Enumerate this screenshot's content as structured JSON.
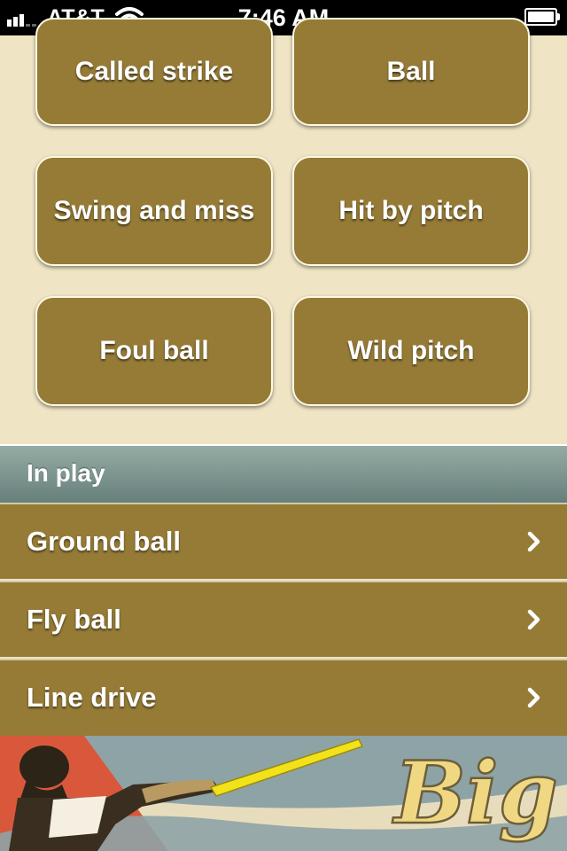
{
  "status_bar": {
    "carrier": "AT&T",
    "time": "7:46 AM"
  },
  "pitch_buttons": [
    {
      "label": "Called strike"
    },
    {
      "label": "Ball"
    },
    {
      "label": "Swing and miss"
    },
    {
      "label": "Hit by pitch"
    },
    {
      "label": "Foul ball"
    },
    {
      "label": "Wild pitch"
    }
  ],
  "in_play": {
    "header": "In play",
    "items": [
      {
        "label": "Ground ball",
        "icon": "chevron-right-icon"
      },
      {
        "label": "Fly ball",
        "icon": "chevron-right-icon"
      },
      {
        "label": "Line drive",
        "icon": "chevron-right-icon"
      }
    ]
  },
  "banner": {
    "text": "Big"
  },
  "colors": {
    "background": "#efe5c5",
    "button": "#957b36",
    "section_header": "#7e9690",
    "banner_red": "#d9583b",
    "banner_blue": "#8ea3a6",
    "banner_cream": "#e7ddbd"
  }
}
